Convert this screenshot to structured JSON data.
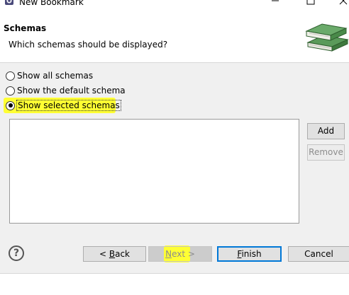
{
  "window": {
    "title": "New Bookmark",
    "icons": {
      "app": "app-icon",
      "minimize": "minimize-icon",
      "maximize": "maximize-icon",
      "close": "close-icon"
    }
  },
  "header": {
    "title": "Schemas",
    "description": "Which schemas should be displayed?",
    "art": "books-icon"
  },
  "options": {
    "show_all": "Show all schemas",
    "show_default": "Show the default schema",
    "show_selected": "Show selected schemas",
    "selected": "show_selected"
  },
  "side_buttons": {
    "add": "Add",
    "remove": "Remove"
  },
  "footer": {
    "help": "?",
    "back_pre": "< ",
    "back_mnemonic": "B",
    "back_post": "ack",
    "next_mnemonic": "N",
    "next_post": "ext >",
    "finish_mnemonic": "F",
    "finish_post": "inish",
    "cancel": "Cancel"
  },
  "colors": {
    "highlight": "#ffff33",
    "default_button_border": "#0078d7"
  }
}
